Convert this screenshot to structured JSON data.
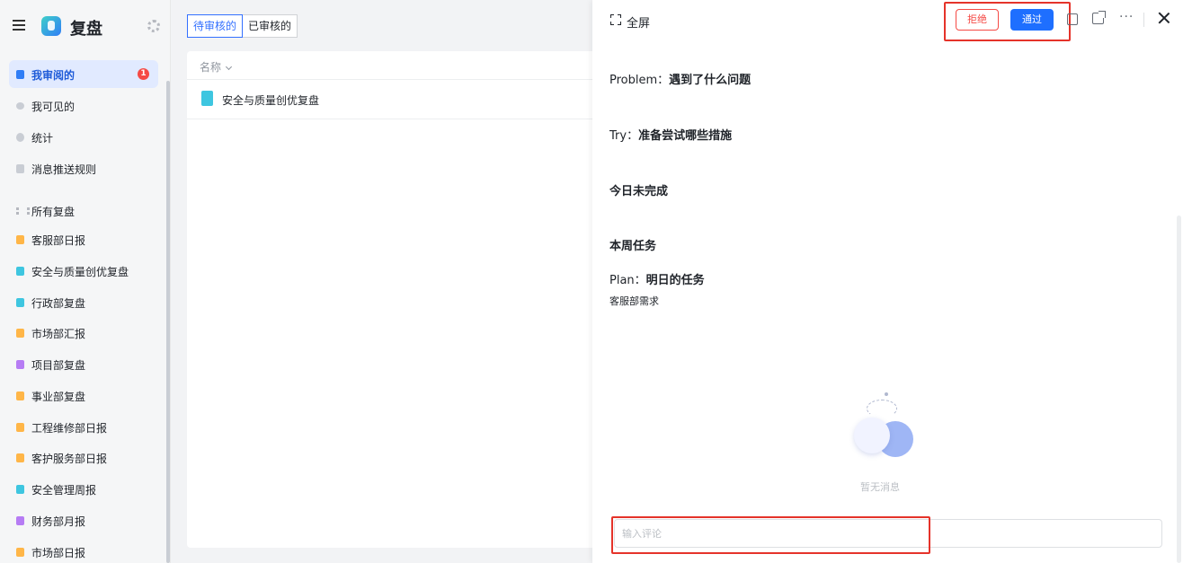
{
  "app": {
    "title": "复盘"
  },
  "sidebar": {
    "items": [
      {
        "label": "我审阅的",
        "badge": "1"
      },
      {
        "label": "我可见的"
      },
      {
        "label": "统计"
      },
      {
        "label": "消息推送规则"
      },
      {
        "label": "所有复盘"
      },
      {
        "label": "客服部日报"
      },
      {
        "label": "安全与质量创优复盘"
      },
      {
        "label": "行政部复盘"
      },
      {
        "label": "市场部汇报"
      },
      {
        "label": "项目部复盘"
      },
      {
        "label": "事业部复盘"
      },
      {
        "label": "工程维修部日报"
      },
      {
        "label": "客护服务部日报"
      },
      {
        "label": "安全管理周报"
      },
      {
        "label": "财务部月报"
      },
      {
        "label": "市场部日报"
      }
    ]
  },
  "list": {
    "tabs": [
      "待审核的",
      "已审核的"
    ],
    "column_header": "名称",
    "rows": [
      {
        "name": "安全与质量创优复盘"
      }
    ]
  },
  "detail": {
    "fullscreen_label": "全屏",
    "reject_label": "拒绝",
    "pass_label": "通过",
    "more_label": "···",
    "sections": [
      {
        "en": "Problem：",
        "title": "遇到了什么问题"
      },
      {
        "en": "Try：",
        "title": "准备尝试哪些措施"
      },
      {
        "title": "今日未完成"
      },
      {
        "title": "本周任务"
      },
      {
        "en": "Plan：",
        "title": "明日的任务"
      }
    ],
    "plan_content": "客服部需求",
    "empty_text": "暂无消息",
    "comment_placeholder": "输入评论"
  },
  "colors": {
    "accent": "#3370ff",
    "pass_button": "#1e6fff",
    "reject": "#f54a45",
    "highlight_box": "#e5332a"
  }
}
